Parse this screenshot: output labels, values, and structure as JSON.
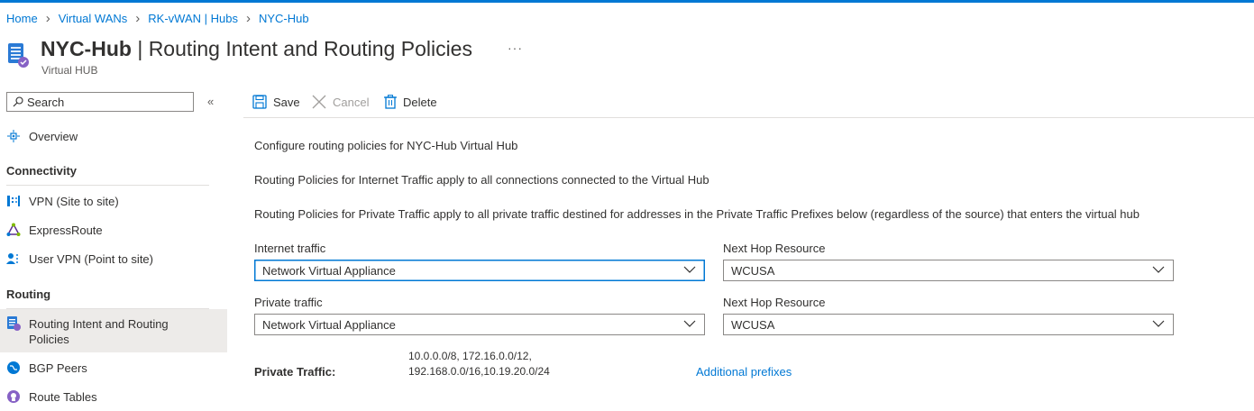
{
  "breadcrumb": [
    "Home",
    "Virtual WANs",
    "RK-vWAN | Hubs",
    "NYC-Hub"
  ],
  "header": {
    "title_bold": "NYC-Hub",
    "title_rest": " | Routing Intent and Routing Policies",
    "subtitle": "Virtual HUB",
    "more": "···"
  },
  "sidebar": {
    "search_placeholder": "Search",
    "collapse": "«",
    "overview": "Overview",
    "sections": {
      "connectivity": "Connectivity",
      "routing": "Routing"
    },
    "connectivity_items": [
      "VPN (Site to site)",
      "ExpressRoute",
      "User VPN (Point to site)"
    ],
    "routing_items": {
      "routing_intent_line1": "Routing Intent and Routing",
      "routing_intent_line2": "Policies",
      "bgp": "BGP Peers",
      "route_tables": "Route Tables"
    }
  },
  "toolbar": {
    "save": "Save",
    "cancel": "Cancel",
    "delete": "Delete"
  },
  "content": {
    "para1": "Configure routing policies for NYC-Hub Virtual Hub",
    "para2": "Routing Policies for Internet Traffic apply to all connections connected to the Virtual Hub",
    "para3": "Routing Policies for Private Traffic apply to all private traffic destined for addresses in the Private Traffic Prefixes below (regardless of the source) that enters the virtual hub",
    "internet_label": "Internet traffic",
    "internet_value": "Network Virtual Appliance",
    "next_hop_label_1": "Next Hop Resource",
    "next_hop_value_1": "WCUSA",
    "private_label": "Private traffic",
    "private_value": "Network Virtual Appliance",
    "next_hop_label_2": "Next Hop Resource",
    "next_hop_value_2": "WCUSA",
    "private_traffic_label": "Private Traffic:",
    "prefixes_line1": "10.0.0.0/8, 172.16.0.0/12,",
    "prefixes_line2": "192.168.0.0/16,10.19.20.0/24",
    "additional_prefixes": "Additional prefixes"
  },
  "colors": {
    "accent": "#0078d4",
    "selected_bg": "#edebe9",
    "disabled": "#a19f9d"
  }
}
